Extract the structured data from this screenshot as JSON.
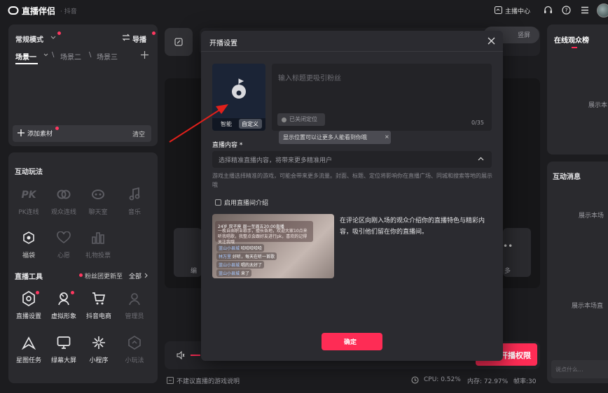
{
  "titlebar": {
    "logo_text": "直播伴侣",
    "app_sub": "· 抖音",
    "live_center": "主播中心"
  },
  "left": {
    "mode_label": "常规模式",
    "guide_label": "导播",
    "scenes": [
      "场景一",
      "场景二",
      "场景三"
    ],
    "add_material": "添加素材",
    "clear": "清空",
    "interactive_title": "互动玩法",
    "interactive_items": [
      {
        "label": "PK连线",
        "icon": "pk-icon"
      },
      {
        "label": "观众连线",
        "icon": "link-icon"
      },
      {
        "label": "聊天室",
        "icon": "chatroom-icon"
      },
      {
        "label": "音乐",
        "icon": "music-icon"
      },
      {
        "label": "福袋",
        "icon": "lucky-bag-icon"
      },
      {
        "label": "心愿",
        "icon": "heart-icon"
      },
      {
        "label": "礼物投票",
        "icon": "vote-icon"
      }
    ],
    "tools_title": "直播工具",
    "fans_update": "粉丝团更新至",
    "all": "全部",
    "tools_items": [
      {
        "label": "直播设置",
        "icon": "settings-hex-icon"
      },
      {
        "label": "虚拟形象",
        "icon": "avatar-icon"
      },
      {
        "label": "抖音电商",
        "icon": "cart-icon"
      },
      {
        "label": "管理员",
        "icon": "admin-icon"
      },
      {
        "label": "星图任务",
        "icon": "star-task-icon"
      },
      {
        "label": "绿幕大屏",
        "icon": "monitor-icon"
      },
      {
        "label": "小程序",
        "icon": "miniapp-icon"
      },
      {
        "label": "小玩法",
        "icon": "minigame-icon"
      }
    ]
  },
  "center": {
    "top_right_label": "竖屏",
    "partial_left_1": "编",
    "partial_right_1": "多",
    "bottom_btn": "开播权限"
  },
  "right": {
    "online_title": "在线观众榜",
    "online_empty": "展示本",
    "messages_title": "互动消息",
    "messages_empty_1": "展示本场",
    "messages_empty_2": "展示本场直",
    "input_placeholder": "说点什么..."
  },
  "status": {
    "tip": "不建议直播的游戏说明",
    "cpu": "CPU: 0.52%",
    "mem": "内存: 72.97%",
    "fps": "帧率:30"
  },
  "modal": {
    "title": "开播设置",
    "cover_smart": "智能",
    "cover_custom": "自定义",
    "title_placeholder": "输入标题更吸引粉丝",
    "location": "已关闭定位",
    "counter": "0/35",
    "tooltip": "显示位置可以让更多人能看到你哦",
    "content_label": "直播内容 *",
    "content_placeholder": "选择精准直播内容，将带来更多精准用户",
    "content_desc": "游戏主播选择精准的游戏，可能会带来更多流量。封面、标题、定位将影响你在直播广场、同城和搜索等地的展示哦",
    "intro_checkbox": "启用直播间介绍",
    "intro_desc": "在评论区向刚入场的观众介绍你的直播特色与精彩内容，吸引他们留在你的直播间。",
    "preview": {
      "header": "24岁  双子座  周一至周五20:00直播",
      "body": "一枚自由职业歌手，擅长各地，欢迎大家10点来听我唱歌，我整点会跟好友进行pk，喜欢的记得关注我哦",
      "chats": [
        {
          "user": "蓝山小县城",
          "text": "哈哈哈哈哈"
        },
        {
          "user": "林万里",
          "text": "好听，每天在听一首歌"
        },
        {
          "user": "蓝山小县城",
          "text": "唱的太好了"
        },
        {
          "user": "蓝山小县城",
          "text": "来了"
        }
      ]
    },
    "confirm": "确定"
  },
  "colors": {
    "accent": "#fe2c55",
    "bg": "#1c1c1f",
    "panel": "#2a2a2e"
  }
}
